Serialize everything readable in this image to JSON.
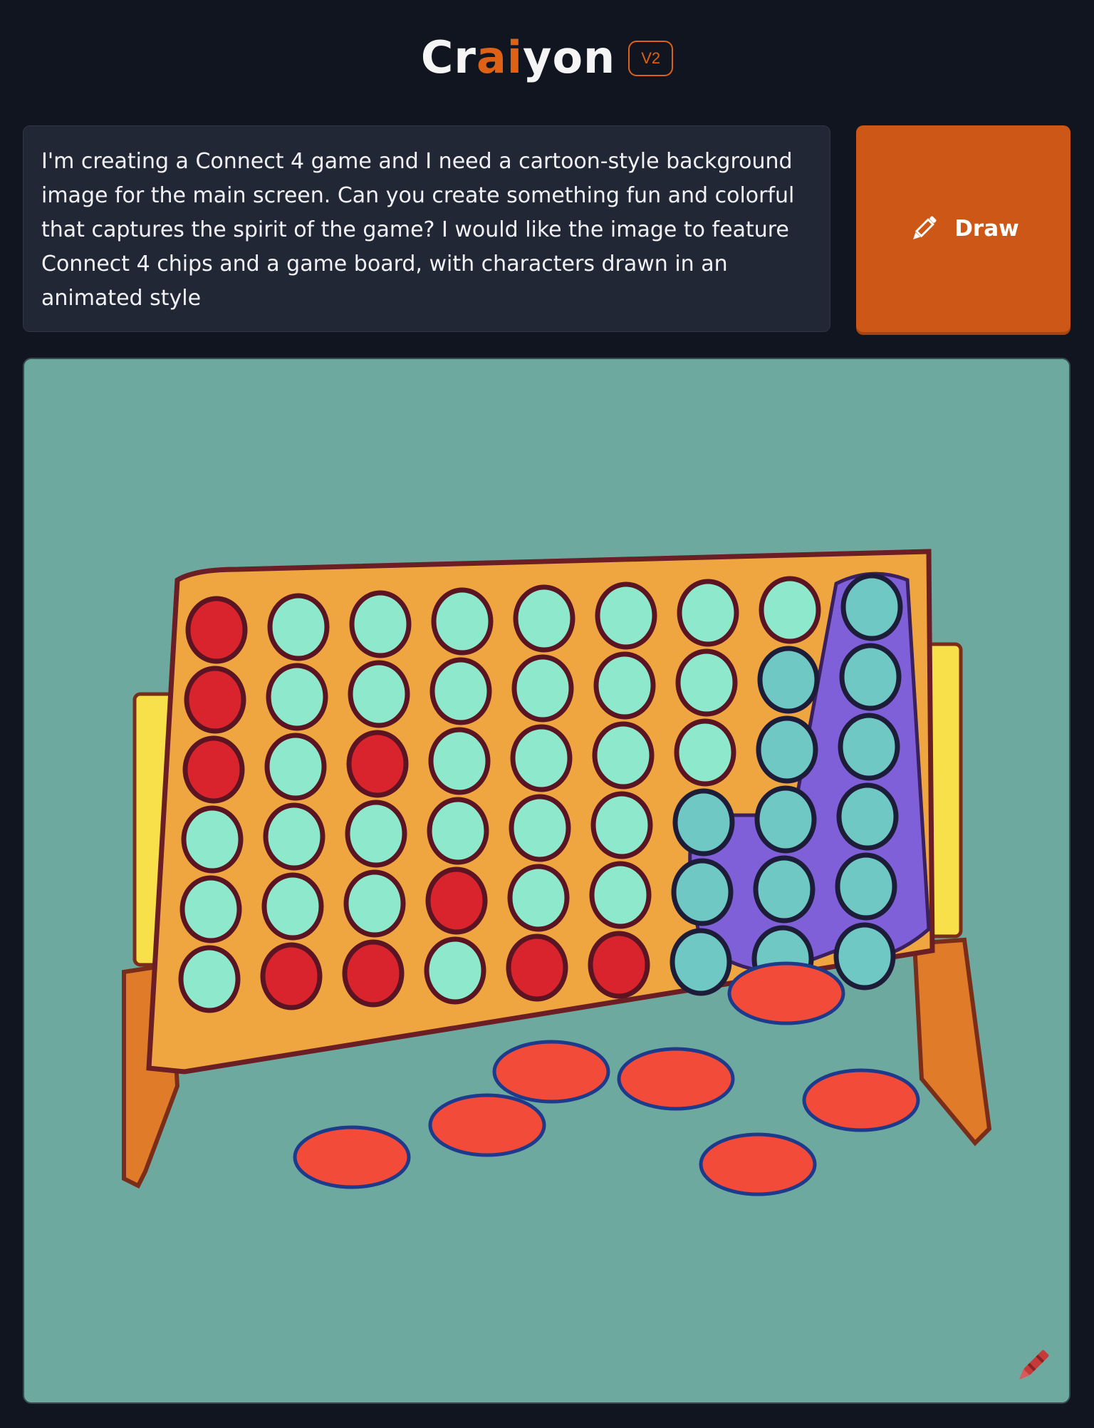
{
  "header": {
    "logo_part1": "Cr",
    "logo_part2": "ai",
    "logo_part3": "yon",
    "version": "V2"
  },
  "prompt": {
    "text": "I'm creating a Connect 4 game and I need a cartoon-style background image for the main screen. Can you create something fun and colorful that captures the spirit of the game? I would like the image to feature Connect 4 chips and a game board, with characters drawn in an animated style"
  },
  "draw_button": {
    "label": "Draw",
    "icon": "pencil-icon"
  },
  "result_image": {
    "icons": [
      "crayon-icon"
    ]
  },
  "colors": {
    "accent": "#dd6216",
    "button": "#cc5716",
    "background": "#11151f",
    "prompt_bg": "#222736",
    "image_bg": "#6ea9a0"
  }
}
